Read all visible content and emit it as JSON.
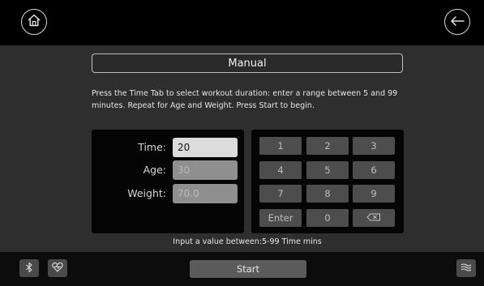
{
  "header": {
    "home_icon": "home-icon",
    "back_icon": "back-arrow-icon"
  },
  "title": "Manual",
  "instructions": "Press the Time Tab to select workout duration: enter a range between 5 and 99 minutes. Repeat for Age and Weight. Press Start to begin.",
  "fields": [
    {
      "label": "Time:",
      "value": "20",
      "active": true
    },
    {
      "label": "Age:",
      "value": "30",
      "active": false
    },
    {
      "label": "Weight:",
      "value": "70.0",
      "active": false
    }
  ],
  "keypad": {
    "keys": [
      "1",
      "2",
      "3",
      "4",
      "5",
      "6",
      "7",
      "8",
      "9",
      "Enter",
      "0"
    ],
    "backspace_icon": "backspace-icon"
  },
  "hint": "Input a value between:5-99 Time mins",
  "footer": {
    "bluetooth_icon": "bluetooth-icon",
    "heart_icon": "heart-rate-icon",
    "start_label": "Start",
    "fan_icon": "fan-icon"
  }
}
